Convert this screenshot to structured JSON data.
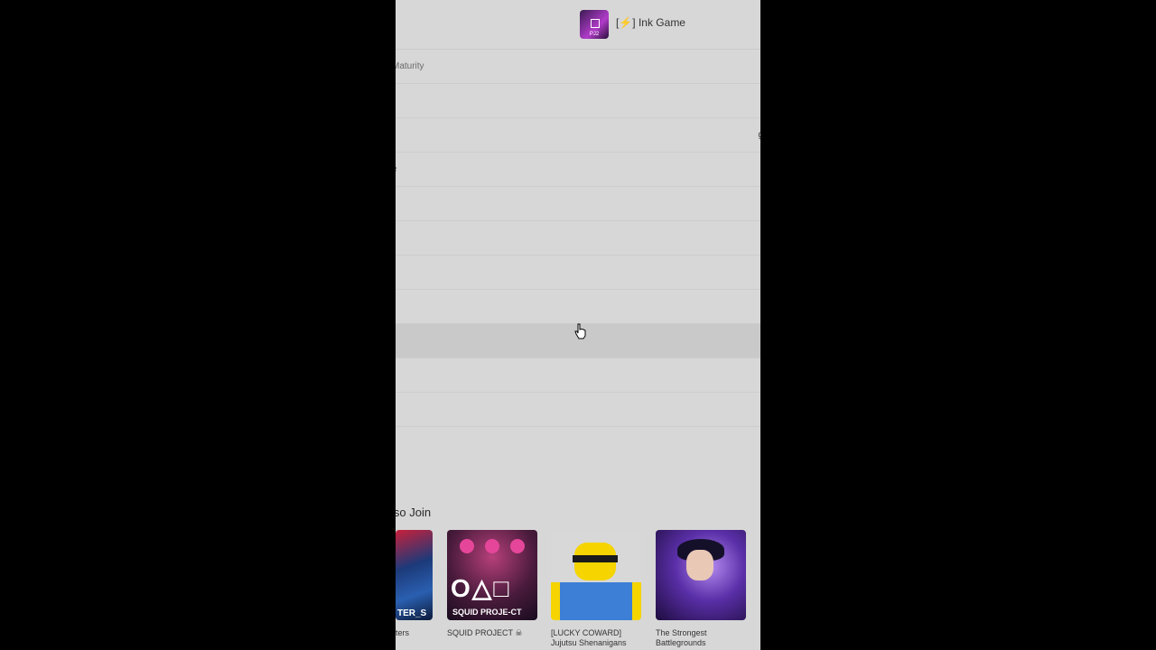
{
  "header": {
    "game_icon_text": "PJ2",
    "game_title_prefix": "[",
    "game_title_bolt": "⚡",
    "game_title_suffix": "] Ink Game"
  },
  "rows": [
    {
      "label": "Maturity",
      "right": ""
    },
    {
      "label": "",
      "right": ""
    },
    {
      "label": "",
      "right": "g"
    },
    {
      "label": "e",
      "right": ""
    },
    {
      "label": "",
      "right": ""
    },
    {
      "label": "",
      "right": ""
    },
    {
      "label": "",
      "right": ""
    },
    {
      "label": "t",
      "right": ""
    },
    {
      "label": "",
      "right": ""
    },
    {
      "label": "",
      "right": ""
    },
    {
      "label": "",
      "right": ""
    }
  ],
  "also_join": {
    "heading": "lso Join",
    "cards": [
      {
        "thumb_text": "TER_S",
        "caption": "ters"
      },
      {
        "thumb_shapes": "O△□",
        "thumb_text": "SQUID PROJE-CT",
        "caption": "SQUID PROJECT ☠"
      },
      {
        "caption": "[LUCKY COWARD] Jujutsu Shenanigans"
      },
      {
        "caption": "The Strongest Battlegrounds"
      }
    ]
  },
  "icons": {
    "cursor": "hand-pointer-icon",
    "skull": "skull-icon",
    "bolt": "lightning-icon"
  },
  "colors": {
    "panel_bg": "#d7d7d7",
    "outer_bg": "#000000",
    "row_highlight": "#c9c9c9"
  }
}
